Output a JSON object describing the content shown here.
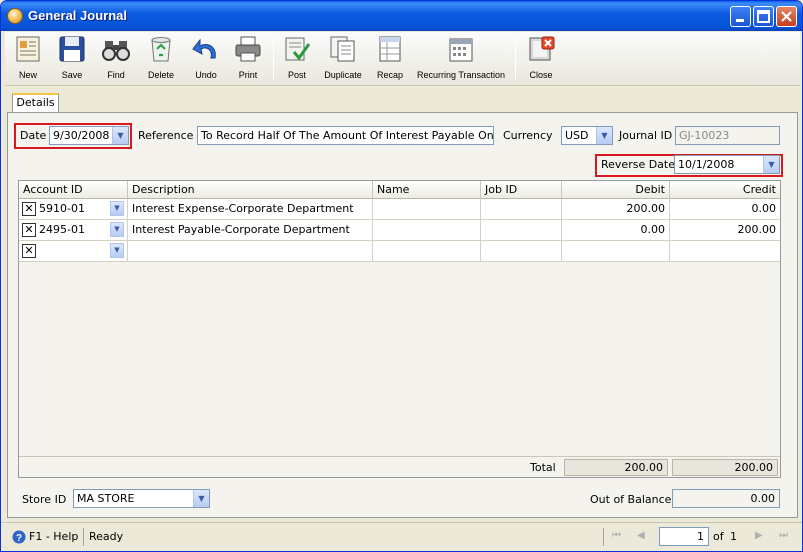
{
  "window": {
    "title": "General Journal"
  },
  "toolbar": {
    "new": "New",
    "save": "Save",
    "find": "Find",
    "delete": "Delete",
    "undo": "Undo",
    "print": "Print",
    "post": "Post",
    "duplicate": "Duplicate",
    "recap": "Recap",
    "recurring": "Recurring Transaction",
    "close": "Close"
  },
  "tabs": {
    "details": "Details"
  },
  "form": {
    "date_label": "Date",
    "date_value": "9/30/2008",
    "reference_label": "Reference",
    "reference_value": "To Record Half Of The Amount Of Interest Payable On Octob",
    "currency_label": "Currency",
    "currency_value": "USD",
    "journal_label": "Journal ID",
    "journal_value": "GJ-10023",
    "reverse_label": "Reverse Date",
    "reverse_value": "10/1/2008"
  },
  "grid": {
    "columns": [
      "Account ID",
      "Description",
      "Name",
      "Job ID",
      "Debit",
      "Credit"
    ],
    "rows": [
      {
        "account": "5910-01",
        "description": "Interest Expense-Corporate Department",
        "name": "",
        "job": "",
        "debit": "200.00",
        "credit": "0.00"
      },
      {
        "account": "2495-01",
        "description": "Interest Payable-Corporate Department",
        "name": "",
        "job": "",
        "debit": "0.00",
        "credit": "200.00"
      },
      {
        "account": "",
        "description": "",
        "name": "",
        "job": "",
        "debit": "",
        "credit": ""
      }
    ],
    "total_label": "Total",
    "total_debit": "200.00",
    "total_credit": "200.00"
  },
  "footer": {
    "store_label": "Store ID",
    "store_value": "MA STORE",
    "oob_label": "Out of Balance",
    "oob_value": "0.00"
  },
  "status": {
    "help": "F1 - Help",
    "state": "Ready",
    "page": "1",
    "of_label": "of",
    "total_pages": "1"
  },
  "colors": {
    "highlight": "#D7181E",
    "title_bar": "#0553D8"
  }
}
